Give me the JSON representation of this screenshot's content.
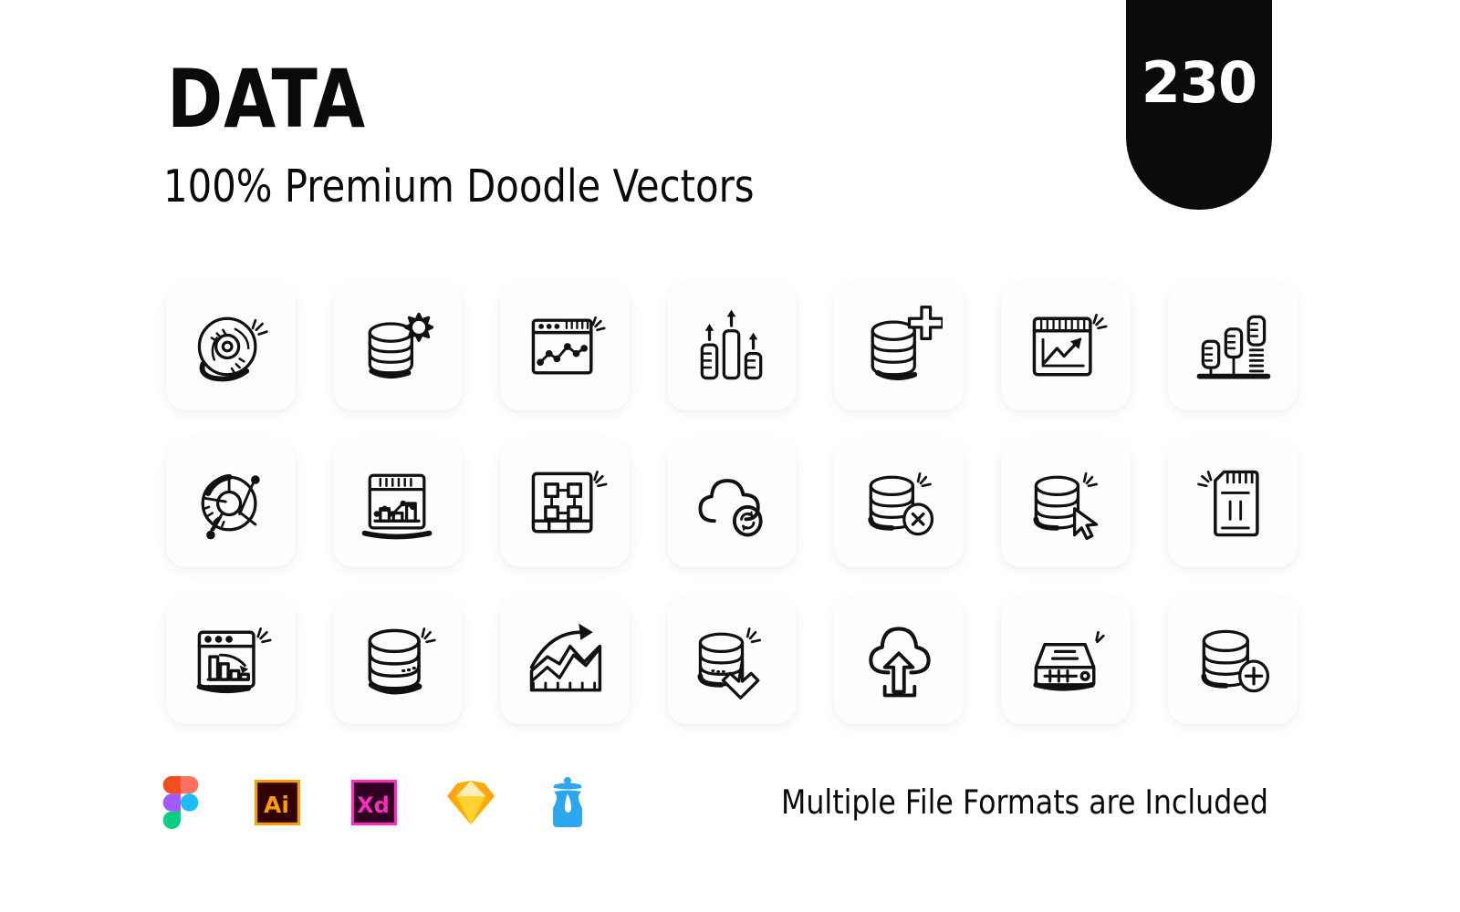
{
  "header": {
    "title": "DATA",
    "subtitle": "100% Premium Doodle Vectors",
    "badge_count": "230"
  },
  "colors": {
    "background": "#ffffff",
    "card_background": "#fdfdfd",
    "badge_background": "#0b0b0b",
    "badge_text": "#ffffff",
    "ink": "#0a0a0a",
    "figma_red": "#f24e1e",
    "figma_orange": "#ff7262",
    "figma_purple": "#a259ff",
    "figma_blue": "#1abcfe",
    "figma_green": "#0acf83",
    "illustrator_bg": "#310000",
    "illustrator_accent": "#ff9a00",
    "xd_bg": "#2e001f",
    "xd_accent": "#ff2bc2",
    "sketch_light": "#fdd231",
    "sketch_mid": "#fdad00",
    "sketch_dark": "#fea11b",
    "sketch_pale": "#feeeb7",
    "iconjar_blue": "#2ba6ef"
  },
  "grid": {
    "columns": 7,
    "rows": 3,
    "icons": [
      {
        "name": "disc-icon",
        "label": "Data Disc"
      },
      {
        "name": "database-settings-icon",
        "label": "Database Settings"
      },
      {
        "name": "browser-line-chart-icon",
        "label": "Line Chart Window"
      },
      {
        "name": "growth-bars-arrows-icon",
        "label": "Growth Bars"
      },
      {
        "name": "database-add-icon",
        "label": "Add Database"
      },
      {
        "name": "report-trend-up-icon",
        "label": "Trending Report"
      },
      {
        "name": "bar-chart-stand-icon",
        "label": "Bar Chart Stand"
      },
      {
        "name": "donut-chart-icon",
        "label": "Donut Chart"
      },
      {
        "name": "dashboard-chart-icon",
        "label": "Dashboard Chart"
      },
      {
        "name": "network-diagram-icon",
        "label": "Network Diagram"
      },
      {
        "name": "cloud-sync-icon",
        "label": "Cloud Sync"
      },
      {
        "name": "database-delete-icon",
        "label": "Delete Database"
      },
      {
        "name": "database-click-icon",
        "label": "Select Database"
      },
      {
        "name": "memory-card-icon",
        "label": "Memory Card"
      },
      {
        "name": "browser-bar-decline-icon",
        "label": "Declining Chart"
      },
      {
        "name": "database-icon",
        "label": "Database"
      },
      {
        "name": "area-chart-arrow-icon",
        "label": "Area Chart Growth"
      },
      {
        "name": "database-download-icon",
        "label": "Download Database"
      },
      {
        "name": "cloud-upload-icon",
        "label": "Cloud Upload"
      },
      {
        "name": "server-device-icon",
        "label": "Server Device"
      },
      {
        "name": "database-plus-icon",
        "label": "Add Record"
      }
    ]
  },
  "footer": {
    "note": "Multiple File Formats are Included",
    "formats": [
      {
        "name": "figma-icon",
        "label": "Figma"
      },
      {
        "name": "illustrator-icon",
        "label": "Ai"
      },
      {
        "name": "xd-icon",
        "label": "Xd"
      },
      {
        "name": "sketch-icon",
        "label": "Sketch"
      },
      {
        "name": "iconjar-icon",
        "label": "IconJar"
      }
    ]
  }
}
